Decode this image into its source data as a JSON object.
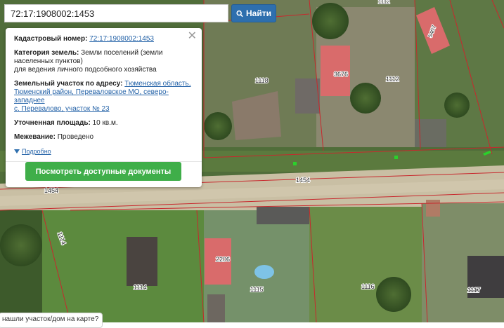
{
  "search": {
    "value": "72:17:1908002:1453",
    "button_label": "Найти"
  },
  "info_panel": {
    "cadastral_label": "Кадастровый номер:",
    "cadastral_value": "72:17:1908002:1453",
    "category_label": "Категория земель:",
    "category_line1": "Земли поселений (земли",
    "category_line2": "населенных пунктов)",
    "category_line3": "для ведения личного подсобного хозяйства",
    "address_label": "Земельный участок по адресу:",
    "address_line1": "Тюменская область,",
    "address_line2": "Тюменский район, Переваловское МО, северо-западнее",
    "address_line3": "с. Перевалово, участок № 23",
    "area_label": "Уточненная площадь:",
    "area_value": "10 кв.м.",
    "survey_label": "Межевание:",
    "survey_value": "Проведено",
    "more_link": "Подробно",
    "docs_button": "Посмотреть доступные документы"
  },
  "bottom_tip": "нашли участок/дом на карте?",
  "map": {
    "parcel_labels": {
      "p1112_top": "1112",
      "p1112": "1112",
      "p1118": "1118",
      "p3676": "3676",
      "p5407": "5407",
      "p1454_left": "1454",
      "p1454": "1454",
      "p1114_left": "1114",
      "p2206": "2206",
      "p1114": "1114",
      "p1115": "1115",
      "p1116": "1116",
      "p1117": "1117"
    },
    "colors": {
      "parcel_line": "#c8282d",
      "building_fill": "#d96b6b",
      "vegetation": "#4b6a34",
      "road": "#c9bfa4",
      "marker": "#2bd12b"
    }
  }
}
